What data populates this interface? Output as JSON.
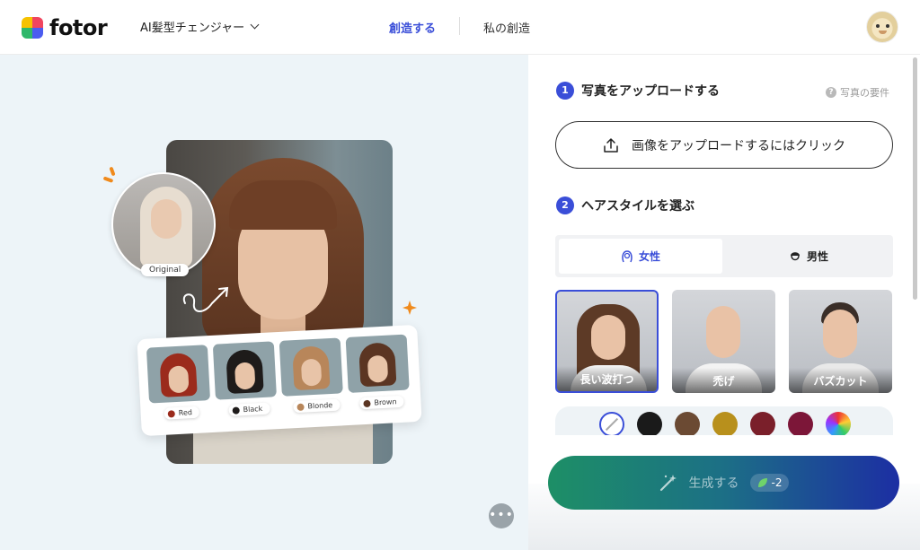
{
  "header": {
    "logo_text": "fotor",
    "tool_select": "AI髪型チェンジャー",
    "nav_create": "創造する",
    "nav_mine": "私の創造"
  },
  "preview": {
    "original_label": "Original",
    "swatches": [
      {
        "label": "Red",
        "hair_color": "#9b2b1c"
      },
      {
        "label": "Black",
        "hair_color": "#1e1b1a"
      },
      {
        "label": "Blonde",
        "hair_color": "#b8865a"
      },
      {
        "label": "Brown",
        "hair_color": "#5b3522"
      }
    ]
  },
  "panel": {
    "step1_num": "1",
    "step1_title": "写真をアップロードする",
    "requirements_link": "写真の要件",
    "upload_button": "画像をアップロードするにはクリック",
    "step2_num": "2",
    "step2_title": "ヘアスタイルを選ぶ",
    "gender_tabs": [
      {
        "label": "女性",
        "active": true
      },
      {
        "label": "男性",
        "active": false
      }
    ],
    "styles": [
      {
        "label": "長い波打つ",
        "selected": true,
        "hair_color": "#5d3a26"
      },
      {
        "label": "禿げ",
        "selected": false,
        "hair_color": "#e0b79a"
      },
      {
        "label": "バズカット",
        "selected": false,
        "hair_color": "#3a2e28"
      }
    ],
    "colors": [
      "none",
      "#1a1a1a",
      "#6b4a33",
      "#b8901c",
      "#7a1f2a",
      "#7c1638",
      "rainbow"
    ],
    "generate_label": "生成する",
    "generate_cost": "-2"
  },
  "colors": {
    "accent": "#3a4ed8"
  }
}
